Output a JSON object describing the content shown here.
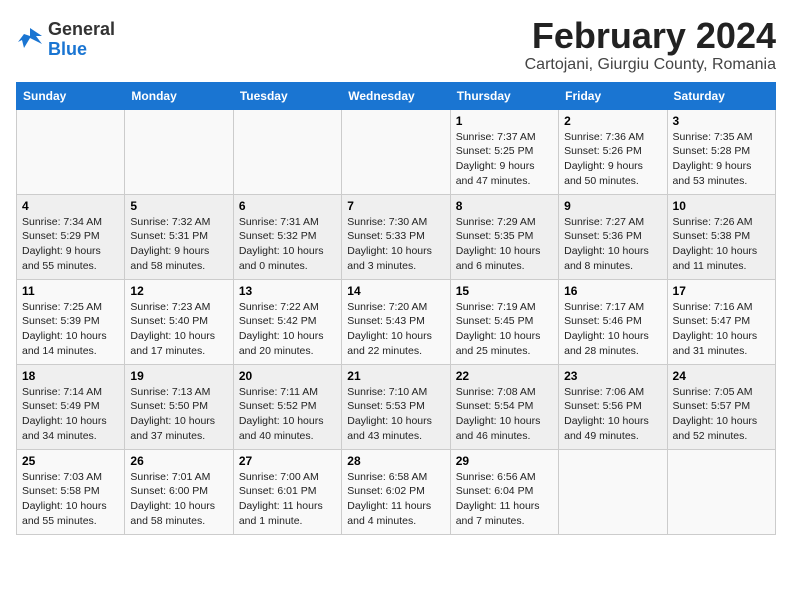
{
  "logo": {
    "general": "General",
    "blue": "Blue"
  },
  "title": "February 2024",
  "subtitle": "Cartojani, Giurgiu County, Romania",
  "days_of_week": [
    "Sunday",
    "Monday",
    "Tuesday",
    "Wednesday",
    "Thursday",
    "Friday",
    "Saturday"
  ],
  "weeks": [
    [
      {
        "day": "",
        "info": ""
      },
      {
        "day": "",
        "info": ""
      },
      {
        "day": "",
        "info": ""
      },
      {
        "day": "",
        "info": ""
      },
      {
        "day": "1",
        "info": "Sunrise: 7:37 AM\nSunset: 5:25 PM\nDaylight: 9 hours and 47 minutes."
      },
      {
        "day": "2",
        "info": "Sunrise: 7:36 AM\nSunset: 5:26 PM\nDaylight: 9 hours and 50 minutes."
      },
      {
        "day": "3",
        "info": "Sunrise: 7:35 AM\nSunset: 5:28 PM\nDaylight: 9 hours and 53 minutes."
      }
    ],
    [
      {
        "day": "4",
        "info": "Sunrise: 7:34 AM\nSunset: 5:29 PM\nDaylight: 9 hours and 55 minutes."
      },
      {
        "day": "5",
        "info": "Sunrise: 7:32 AM\nSunset: 5:31 PM\nDaylight: 9 hours and 58 minutes."
      },
      {
        "day": "6",
        "info": "Sunrise: 7:31 AM\nSunset: 5:32 PM\nDaylight: 10 hours and 0 minutes."
      },
      {
        "day": "7",
        "info": "Sunrise: 7:30 AM\nSunset: 5:33 PM\nDaylight: 10 hours and 3 minutes."
      },
      {
        "day": "8",
        "info": "Sunrise: 7:29 AM\nSunset: 5:35 PM\nDaylight: 10 hours and 6 minutes."
      },
      {
        "day": "9",
        "info": "Sunrise: 7:27 AM\nSunset: 5:36 PM\nDaylight: 10 hours and 8 minutes."
      },
      {
        "day": "10",
        "info": "Sunrise: 7:26 AM\nSunset: 5:38 PM\nDaylight: 10 hours and 11 minutes."
      }
    ],
    [
      {
        "day": "11",
        "info": "Sunrise: 7:25 AM\nSunset: 5:39 PM\nDaylight: 10 hours and 14 minutes."
      },
      {
        "day": "12",
        "info": "Sunrise: 7:23 AM\nSunset: 5:40 PM\nDaylight: 10 hours and 17 minutes."
      },
      {
        "day": "13",
        "info": "Sunrise: 7:22 AM\nSunset: 5:42 PM\nDaylight: 10 hours and 20 minutes."
      },
      {
        "day": "14",
        "info": "Sunrise: 7:20 AM\nSunset: 5:43 PM\nDaylight: 10 hours and 22 minutes."
      },
      {
        "day": "15",
        "info": "Sunrise: 7:19 AM\nSunset: 5:45 PM\nDaylight: 10 hours and 25 minutes."
      },
      {
        "day": "16",
        "info": "Sunrise: 7:17 AM\nSunset: 5:46 PM\nDaylight: 10 hours and 28 minutes."
      },
      {
        "day": "17",
        "info": "Sunrise: 7:16 AM\nSunset: 5:47 PM\nDaylight: 10 hours and 31 minutes."
      }
    ],
    [
      {
        "day": "18",
        "info": "Sunrise: 7:14 AM\nSunset: 5:49 PM\nDaylight: 10 hours and 34 minutes."
      },
      {
        "day": "19",
        "info": "Sunrise: 7:13 AM\nSunset: 5:50 PM\nDaylight: 10 hours and 37 minutes."
      },
      {
        "day": "20",
        "info": "Sunrise: 7:11 AM\nSunset: 5:52 PM\nDaylight: 10 hours and 40 minutes."
      },
      {
        "day": "21",
        "info": "Sunrise: 7:10 AM\nSunset: 5:53 PM\nDaylight: 10 hours and 43 minutes."
      },
      {
        "day": "22",
        "info": "Sunrise: 7:08 AM\nSunset: 5:54 PM\nDaylight: 10 hours and 46 minutes."
      },
      {
        "day": "23",
        "info": "Sunrise: 7:06 AM\nSunset: 5:56 PM\nDaylight: 10 hours and 49 minutes."
      },
      {
        "day": "24",
        "info": "Sunrise: 7:05 AM\nSunset: 5:57 PM\nDaylight: 10 hours and 52 minutes."
      }
    ],
    [
      {
        "day": "25",
        "info": "Sunrise: 7:03 AM\nSunset: 5:58 PM\nDaylight: 10 hours and 55 minutes."
      },
      {
        "day": "26",
        "info": "Sunrise: 7:01 AM\nSunset: 6:00 PM\nDaylight: 10 hours and 58 minutes."
      },
      {
        "day": "27",
        "info": "Sunrise: 7:00 AM\nSunset: 6:01 PM\nDaylight: 11 hours and 1 minute."
      },
      {
        "day": "28",
        "info": "Sunrise: 6:58 AM\nSunset: 6:02 PM\nDaylight: 11 hours and 4 minutes."
      },
      {
        "day": "29",
        "info": "Sunrise: 6:56 AM\nSunset: 6:04 PM\nDaylight: 11 hours and 7 minutes."
      },
      {
        "day": "",
        "info": ""
      },
      {
        "day": "",
        "info": ""
      }
    ]
  ]
}
